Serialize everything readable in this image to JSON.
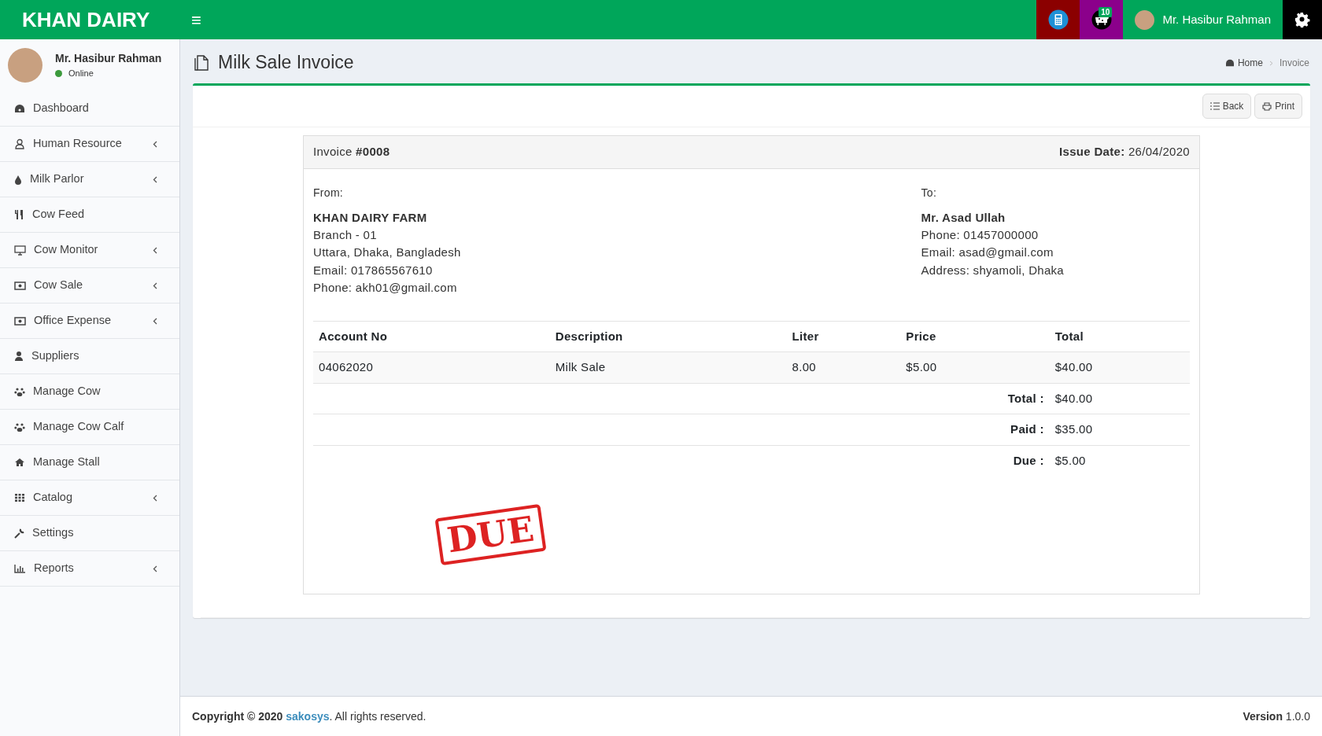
{
  "navbar": {
    "brand": "KHAN DAIRY",
    "menu_toggle": "≡",
    "notification_count": "10",
    "user_name": "Mr. Hasibur Rahman"
  },
  "sidebar": {
    "user": {
      "name": "Mr. Hasibur Rahman",
      "status": "Online"
    },
    "items": [
      {
        "label": "Dashboard",
        "expandable": false
      },
      {
        "label": "Human Resource",
        "expandable": true
      },
      {
        "label": "Milk Parlor",
        "expandable": true
      },
      {
        "label": "Cow Feed",
        "expandable": false
      },
      {
        "label": "Cow Monitor",
        "expandable": true
      },
      {
        "label": "Cow Sale",
        "expandable": true
      },
      {
        "label": "Office Expense",
        "expandable": true
      },
      {
        "label": "Suppliers",
        "expandable": false
      },
      {
        "label": "Manage Cow",
        "expandable": false
      },
      {
        "label": "Manage Cow Calf",
        "expandable": false
      },
      {
        "label": "Manage Stall",
        "expandable": false
      },
      {
        "label": "Catalog",
        "expandable": true
      },
      {
        "label": "Settings",
        "expandable": false
      },
      {
        "label": "Reports",
        "expandable": true
      }
    ]
  },
  "page": {
    "title": "Milk Sale Invoice",
    "breadcrumb": [
      "Home",
      "Invoice"
    ]
  },
  "actions": [
    "Back",
    "Print"
  ],
  "invoice": {
    "number": "Invoice **#0008**",
    "issue_date": "**Issue Date:** 26/04/2020",
    "from": {
      "label": "From:",
      "name": "KHAN DAIRY FARM",
      "lines": [
        "Branch - 01",
        "Uttara, Dhaka, Bangladesh",
        "Email: 017865567610",
        "Phone: akh01@gmail.com"
      ]
    },
    "to": {
      "label": "To:",
      "name": "Mr. Asad Ullah",
      "lines": [
        "Phone: 01457000000",
        "Email: asad@gmail.com",
        "Address: shyamoli, Dhaka"
      ]
    },
    "table": {
      "columns": [
        "Account No",
        "Description",
        "Liter",
        "Price",
        "Total"
      ],
      "rows": [
        [
          "04062020",
          "Milk Sale",
          "8.00",
          "$5.00",
          "$40.00"
        ]
      ]
    },
    "summary": [
      {
        "label": "Total :",
        "value": "$40.00"
      },
      {
        "label": "Paid :",
        "value": "$35.00"
      },
      {
        "label": "Due :",
        "value": "$5.00"
      }
    ],
    "stamp": "DUE"
  },
  "footer": {
    "copyright": "Copyright © 2020",
    "link": "sakosys",
    "rest": ". All rights reserved.",
    "version": "**Version** 1.0.0"
  }
}
